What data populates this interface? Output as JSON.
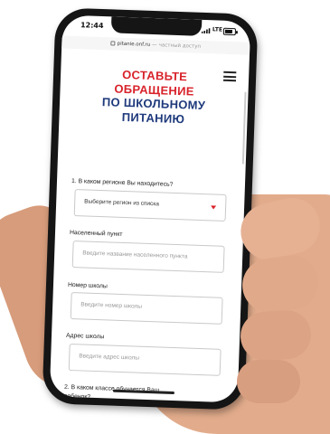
{
  "status": {
    "time": "12:44",
    "network": "LTE",
    "battery_level": 0.8
  },
  "browser": {
    "host": "pitanie.onf.ru",
    "separator": "—",
    "access_label": "частный доступ"
  },
  "page": {
    "title_line1": "ОСТАВЬТЕ",
    "title_line2": "ОБРАЩЕНИЕ",
    "title_line3": "ПО ШКОЛЬНОМУ",
    "title_line4": "ПИТАНИЮ",
    "menu_icon": "hamburger-menu-icon"
  },
  "form": {
    "q1_label": "1. В каком регионе Вы находитесь?",
    "region_select_value": "Выберите регион из списка",
    "city_label": "Населенный пункт",
    "city_placeholder": "Введите название населенного пункта",
    "school_number_label": "Номер школы",
    "school_number_placeholder": "Введите номер школы",
    "school_address_label": "Адрес школы",
    "school_address_placeholder": "Введите адрес школы",
    "q2_label_line1": "2. В каком классе обучается Ваш",
    "q2_label_line2": "ребенок?"
  },
  "colors": {
    "title_red": "#d8222a",
    "title_blue": "#1f3a7c"
  }
}
